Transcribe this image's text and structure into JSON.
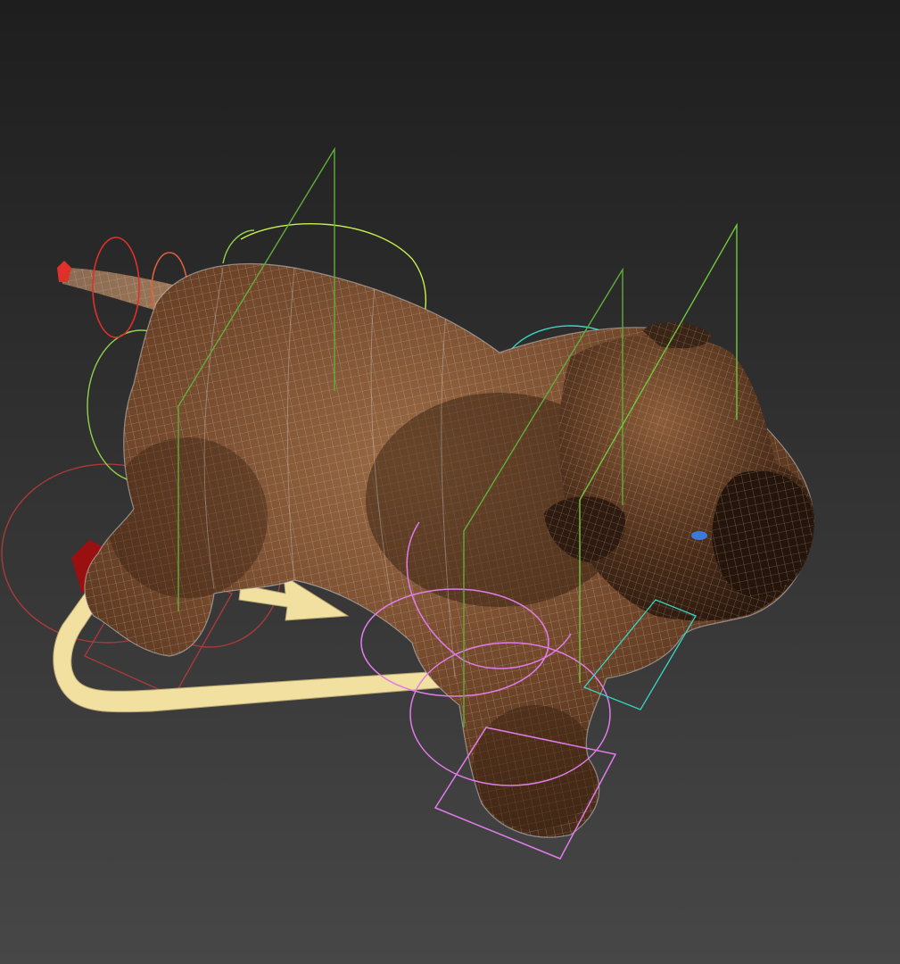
{
  "viewport": {
    "background_top": "#1e1e1e",
    "background_bottom": "#474747",
    "model": "bulldog",
    "mesh_fill_dark": "#3b2414",
    "mesh_fill_light": "#9a6a44",
    "wireframe_color": "#d8d8d8"
  },
  "rig_controls": {
    "spine_color": "#8fd14a",
    "spine_bright_color": "#c7f24a",
    "tail_color": "#e0302a",
    "tail_mid_color": "#e0603a",
    "neck_color": "#35d8c4",
    "front_leg_color": "#e07ce8",
    "back_leg_color": "#a83a3a",
    "root_arrow_color": "#f2e0a0",
    "root_arrow_marker_color": "#9a1010",
    "eye_color": "#3a7ad8"
  }
}
